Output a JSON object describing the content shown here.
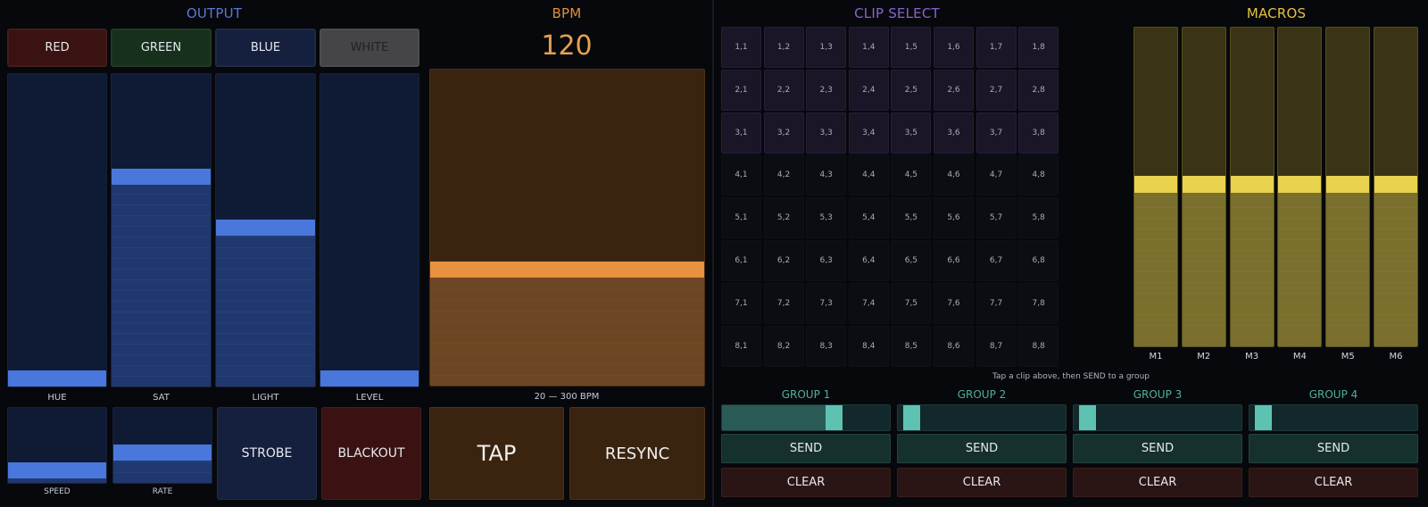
{
  "output": {
    "title": "OUTPUT",
    "color_buttons": [
      {
        "label": "RED",
        "color": "#3a1212"
      },
      {
        "label": "GREEN",
        "color": "#16301c"
      },
      {
        "label": "BLUE",
        "color": "#14203d"
      },
      {
        "label": "WHITE",
        "color": "#454547"
      }
    ],
    "faders": [
      {
        "label": "HUE",
        "value": 0
      },
      {
        "label": "SAT",
        "value": 0.68
      },
      {
        "label": "LIGHT",
        "value": 0.51
      },
      {
        "label": "LEVEL",
        "value": 0
      }
    ],
    "small_faders": [
      {
        "label": "SPEED",
        "value": 0.08
      },
      {
        "label": "RATE",
        "value": 0.38
      }
    ],
    "strobe_label": "STROBE",
    "blackout_label": "BLACKOUT",
    "accent": "#4a77db"
  },
  "bpm": {
    "title": "BPM",
    "value": "120",
    "fader_value": 0.36,
    "range_label": "20 — 300 BPM",
    "tap_label": "TAP",
    "resync_label": "RESYNC",
    "accent": "#e8913e"
  },
  "clip_select": {
    "title": "CLIP SELECT",
    "rows": [
      [
        "1,1",
        "1,2",
        "1,3",
        "1,4",
        "1,5",
        "1,6",
        "1,7",
        "1,8"
      ],
      [
        "2,1",
        "2,2",
        "2,3",
        "2,4",
        "2,5",
        "2,6",
        "2,7",
        "2,8"
      ],
      [
        "3,1",
        "3,2",
        "3,3",
        "3,4",
        "3,5",
        "3,6",
        "3,7",
        "3,8"
      ],
      [
        "4,1",
        "4,2",
        "4,3",
        "4,4",
        "4,5",
        "4,6",
        "4,7",
        "4,8"
      ],
      [
        "5,1",
        "5,2",
        "5,3",
        "5,4",
        "5,5",
        "5,6",
        "5,7",
        "5,8"
      ],
      [
        "6,1",
        "6,2",
        "6,3",
        "6,4",
        "6,5",
        "6,6",
        "6,7",
        "6,8"
      ],
      [
        "7,1",
        "7,2",
        "7,3",
        "7,4",
        "7,5",
        "7,6",
        "7,7",
        "7,8"
      ],
      [
        "8,1",
        "8,2",
        "8,3",
        "8,4",
        "8,5",
        "8,6",
        "8,7",
        "8,8"
      ]
    ],
    "active_rows": 3,
    "hint": "Tap a clip above, then SEND to a group"
  },
  "macros": {
    "title": "MACROS",
    "items": [
      {
        "label": "M1",
        "value": 0.51
      },
      {
        "label": "M2",
        "value": 0.51
      },
      {
        "label": "M3",
        "value": 0.51
      },
      {
        "label": "M4",
        "value": 0.51
      },
      {
        "label": "M5",
        "value": 0.51
      },
      {
        "label": "M6",
        "value": 0.51
      }
    ],
    "accent": "#e8d24e"
  },
  "groups": [
    {
      "title": "GROUP 1",
      "value": 0.7,
      "send_label": "SEND",
      "clear_label": "CLEAR"
    },
    {
      "title": "GROUP 2",
      "value": 0,
      "send_label": "SEND",
      "clear_label": "CLEAR"
    },
    {
      "title": "GROUP 3",
      "value": 0,
      "send_label": "SEND",
      "clear_label": "CLEAR"
    },
    {
      "title": "GROUP 4",
      "value": 0,
      "send_label": "SEND",
      "clear_label": "CLEAR"
    }
  ]
}
